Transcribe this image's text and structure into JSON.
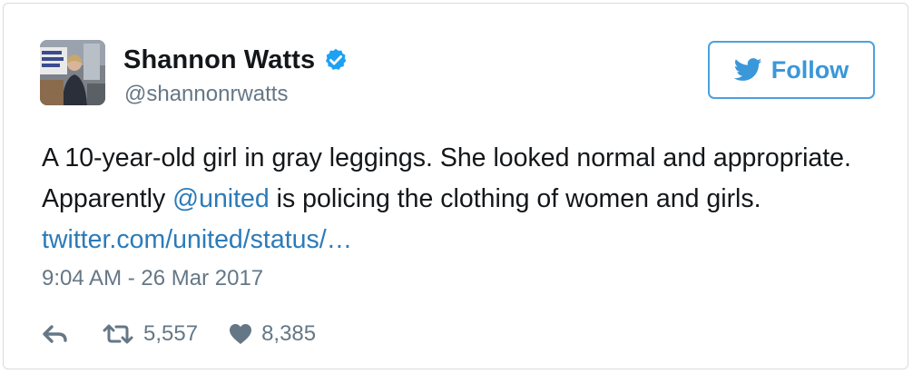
{
  "user": {
    "display_name": "Shannon Watts",
    "handle": "@shannonrwatts",
    "verified": true,
    "avatar_icon": "profile-photo"
  },
  "follow_button": {
    "label": "Follow",
    "icon": "twitter-bird-icon"
  },
  "tweet": {
    "text_part1": "A 10-year-old girl in gray leggings. She looked normal and appropriate. Apparently ",
    "mention": "@united",
    "text_part2": " is policing the clothing of women and girls. ",
    "link": "twitter.com/united/status/…"
  },
  "timestamp": "9:04 AM - 26 Mar 2017",
  "actions": {
    "reply_icon": "reply-icon",
    "retweet_count": "5,557",
    "like_count": "8,385"
  },
  "colors": {
    "accent": "#1da1f2",
    "link": "#2b7bb9",
    "muted": "#657786",
    "text": "#14171a",
    "border": "#d6dce0"
  }
}
